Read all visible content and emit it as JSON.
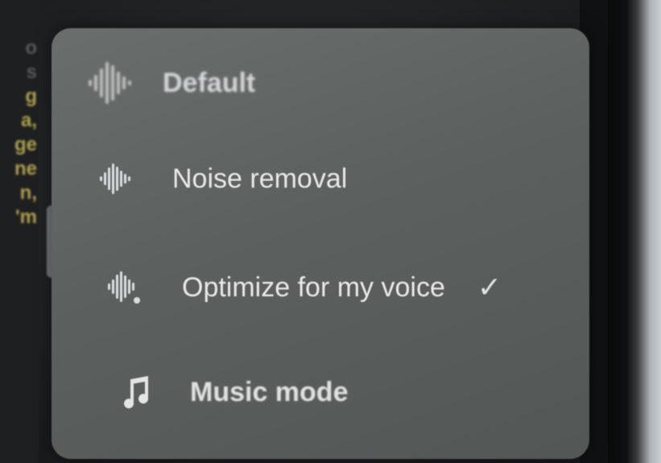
{
  "left_captions": [
    "o",
    "s",
    "g",
    "a,",
    "ge",
    "ne",
    "n,",
    "'m"
  ],
  "menu": {
    "items": [
      {
        "id": "default",
        "label": "Default",
        "icon": "waveform-icon",
        "selected": false
      },
      {
        "id": "noise_removal",
        "label": "Noise removal",
        "icon": "waveform-icon",
        "selected": false
      },
      {
        "id": "optimize_voice",
        "label": "Optimize for my voice",
        "icon": "voice-waveform-icon",
        "selected": true,
        "check": "✓"
      },
      {
        "id": "music_mode",
        "label": "Music mode",
        "icon": "music-note-icon",
        "selected": false
      }
    ]
  },
  "colors": {
    "menu_bg": "#5c605f",
    "text": "#e7e9e9",
    "caption_yellow": "#c8b75a"
  }
}
